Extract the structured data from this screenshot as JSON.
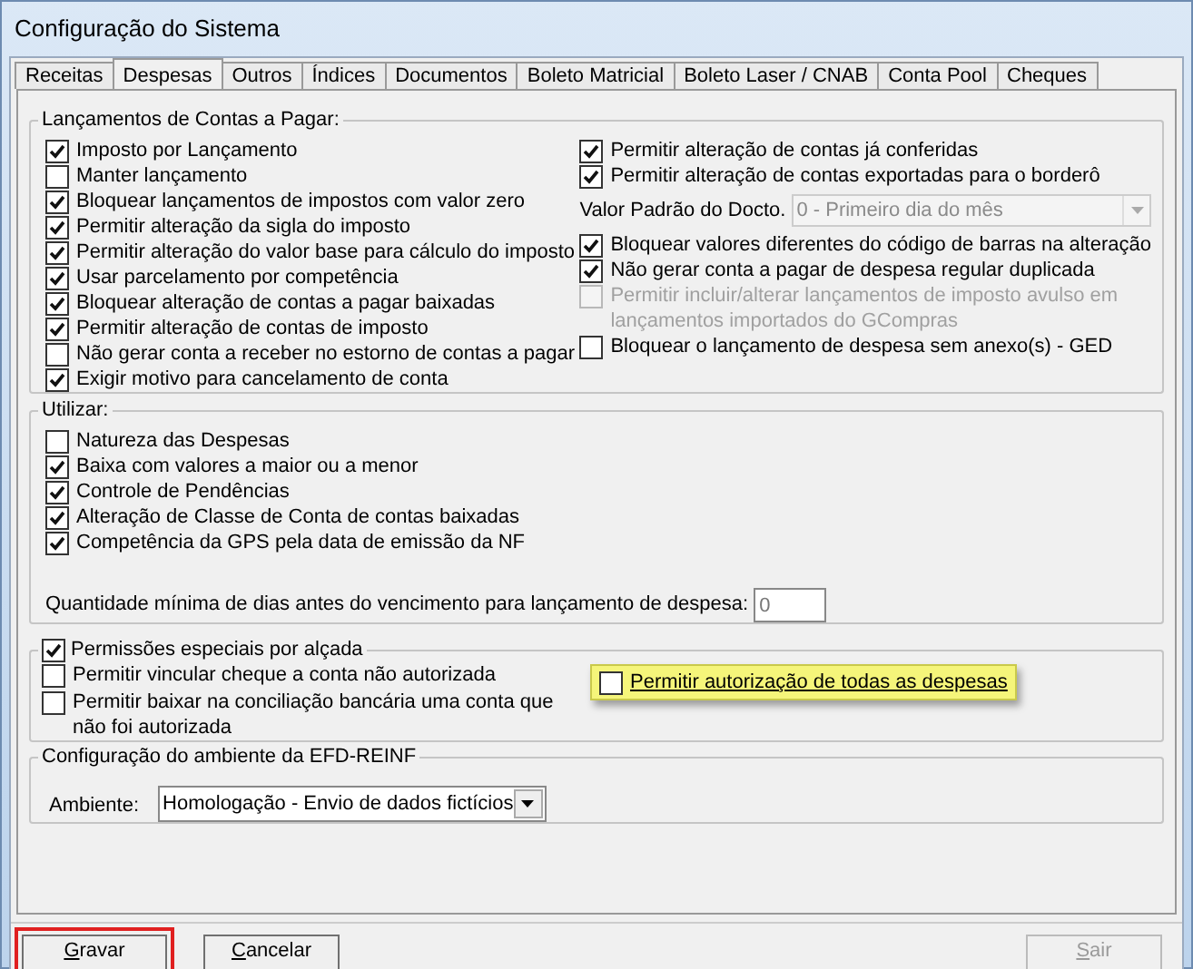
{
  "window": {
    "title": "Configuração do Sistema"
  },
  "tabs": [
    {
      "label": "Receitas",
      "selected": false
    },
    {
      "label": "Despesas",
      "selected": true
    },
    {
      "label": "Outros",
      "selected": false
    },
    {
      "label": "Índices",
      "selected": false
    },
    {
      "label": "Documentos",
      "selected": false
    },
    {
      "label": "Boleto Matricial",
      "selected": false
    },
    {
      "label": "Boleto Laser / CNAB",
      "selected": false
    },
    {
      "label": "Conta Pool",
      "selected": false
    },
    {
      "label": "Cheques",
      "selected": false
    }
  ],
  "lancamentos": {
    "title": "Lançamentos de Contas a Pagar:",
    "left": [
      {
        "label": "Imposto por Lançamento",
        "checked": true
      },
      {
        "label": "Manter lançamento",
        "checked": false
      },
      {
        "label": "Bloquear lançamentos de impostos com valor zero",
        "checked": true
      },
      {
        "label": "Permitir alteração da sigla do imposto",
        "checked": true
      },
      {
        "label": "Permitir alteração do valor base para cálculo do imposto",
        "checked": true
      },
      {
        "label": "Usar parcelamento por competência",
        "checked": true
      },
      {
        "label": "Bloquear alteração de contas a pagar baixadas",
        "checked": true
      },
      {
        "label": "Permitir alteração de contas de imposto",
        "checked": true
      },
      {
        "label": "Não gerar conta a receber no estorno de contas a pagar",
        "checked": false
      },
      {
        "label": "Exigir motivo para cancelamento de conta",
        "checked": true
      }
    ],
    "right": [
      {
        "kind": "checkbox",
        "label": "Permitir alteração de contas já conferidas",
        "checked": true,
        "disabled": false
      },
      {
        "kind": "checkbox",
        "label": "Permitir alteração de contas exportadas para o borderô",
        "checked": true,
        "disabled": false
      },
      {
        "kind": "select",
        "label": "Valor Padrão do Docto.",
        "value": "0 - Primeiro dia do mês",
        "disabled": true
      },
      {
        "kind": "checkbox",
        "label": "Bloquear valores diferentes do código de barras na alteração",
        "checked": true,
        "disabled": false
      },
      {
        "kind": "checkbox",
        "label": "Não gerar conta a pagar de despesa regular duplicada",
        "checked": true,
        "disabled": false
      },
      {
        "kind": "checkbox",
        "label": "Permitir incluir/alterar lançamentos de imposto avulso em lançamentos importados do GCompras",
        "checked": false,
        "disabled": true
      },
      {
        "kind": "checkbox",
        "label": "Bloquear o lançamento de despesa sem anexo(s) - GED",
        "checked": false,
        "disabled": false
      }
    ]
  },
  "utilizar": {
    "title": "Utilizar:",
    "items": [
      {
        "label": "Natureza das Despesas",
        "checked": false
      },
      {
        "label": "Baixa com valores a maior ou a menor",
        "checked": true
      },
      {
        "label": "Controle de Pendências",
        "checked": true
      },
      {
        "label": "Alteração de Classe de Conta de contas baixadas",
        "checked": true
      },
      {
        "label": "Competência da GPS pela data de emissão da NF",
        "checked": true
      }
    ],
    "quantity": {
      "label": "Quantidade mínima de dias antes do vencimento para lançamento de despesa:",
      "value": "0"
    }
  },
  "permissoes": {
    "label": "Permissões especiais por alçada",
    "checked": true,
    "items": [
      {
        "label": "Permitir vincular cheque a conta não autorizada",
        "checked": false,
        "highlighted": false
      },
      {
        "label": "Permitir autorização de todas as despesas",
        "checked": false,
        "highlighted": true
      },
      {
        "label": "Permitir baixar na conciliação bancária uma conta que não foi autorizada",
        "checked": false,
        "highlighted": false
      }
    ]
  },
  "efd": {
    "title": "Configuração do ambiente da EFD-REINF",
    "label": "Ambiente:",
    "value": "Homologação - Envio de dados fictícios"
  },
  "buttons": [
    {
      "label": "Gravar",
      "disabled": false,
      "highlighted": true
    },
    {
      "label": "Cancelar",
      "disabled": false,
      "highlighted": false
    },
    {
      "label": "Sair",
      "disabled": true,
      "highlighted": false
    }
  ]
}
